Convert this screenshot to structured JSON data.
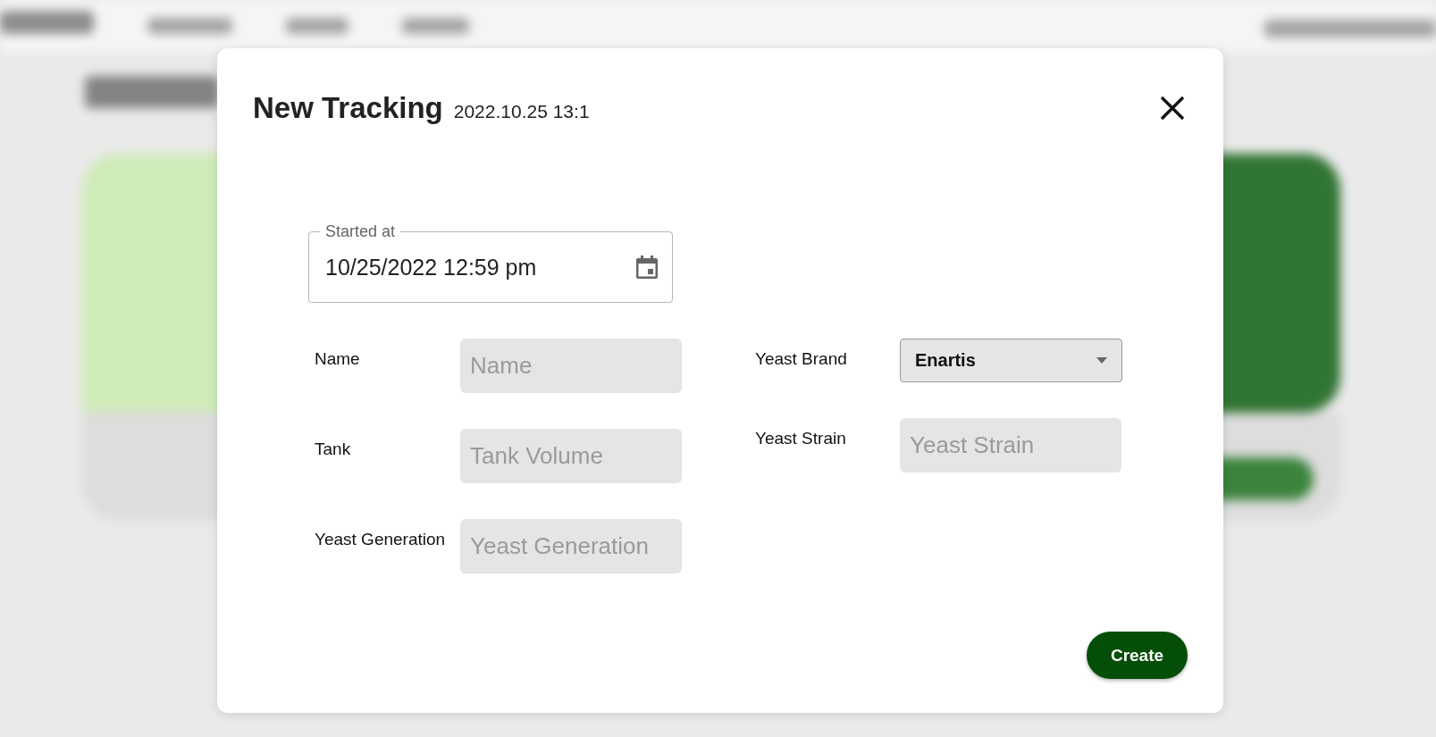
{
  "dialog": {
    "title": "New Tracking",
    "timestamp": "2022.10.25 13:1"
  },
  "started_at": {
    "label": "Started at",
    "value": "10/25/2022 12:59 pm"
  },
  "left_fields": [
    {
      "kind": "input",
      "label": "Name",
      "placeholder": "Name"
    },
    {
      "kind": "input",
      "label": "Tank",
      "placeholder": "Tank Volume"
    },
    {
      "kind": "input",
      "label": "Yeast Generation",
      "placeholder": "Yeast Generation"
    }
  ],
  "right_fields": [
    {
      "kind": "select",
      "label": "Yeast Brand",
      "value": "Enartis"
    },
    {
      "kind": "input",
      "label": "Yeast Strain",
      "placeholder": "Yeast Strain"
    }
  ],
  "create_button": "Create"
}
